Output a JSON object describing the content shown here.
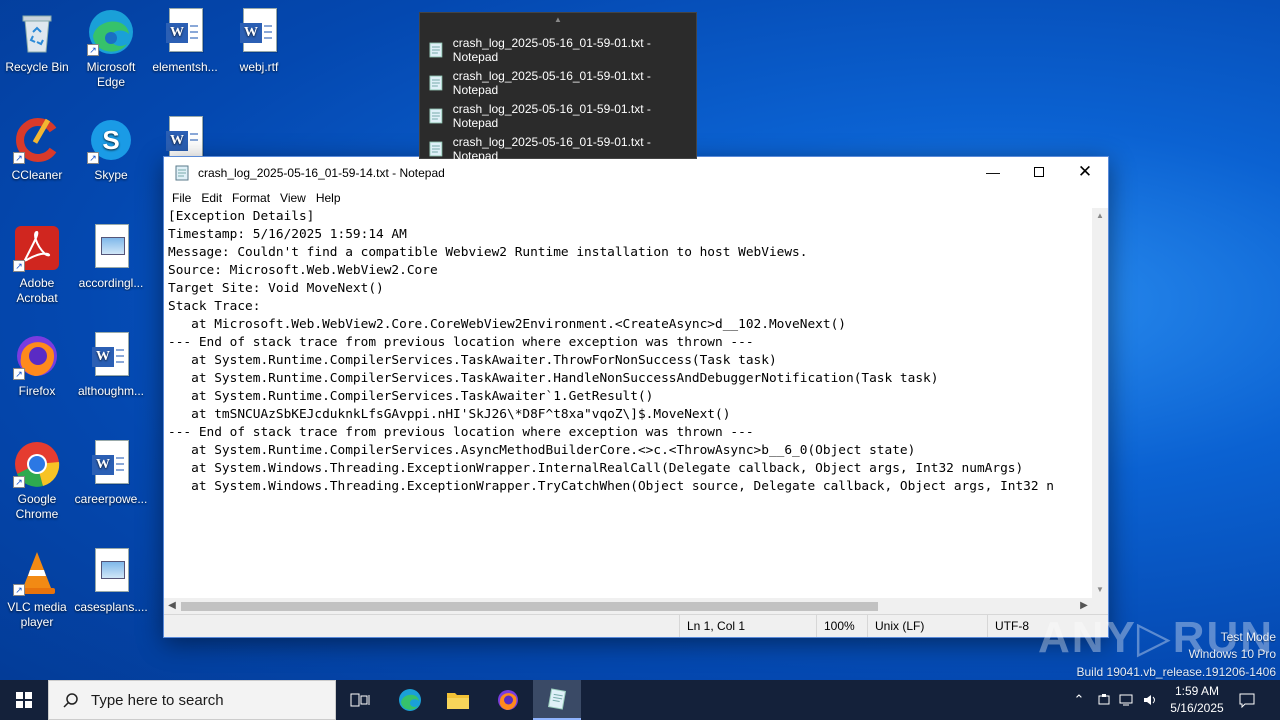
{
  "desktop": {
    "icons": [
      {
        "label": "Recycle Bin"
      },
      {
        "label": "Microsoft Edge"
      },
      {
        "label": "elementsh..."
      },
      {
        "label": "webj.rtf"
      },
      {
        "label": "CCleaner"
      },
      {
        "label": "Skype"
      },
      {
        "label": "Adobe Acrobat"
      },
      {
        "label": "accordingl..."
      },
      {
        "label": "Firefox"
      },
      {
        "label": "althoughm..."
      },
      {
        "label": "Google Chrome"
      },
      {
        "label": "careerpowe..."
      },
      {
        "label": "VLC media player"
      },
      {
        "label": "casesplans...."
      }
    ]
  },
  "jumplist": {
    "items": [
      "crash_log_2025-05-16_01-59-01.txt - Notepad",
      "crash_log_2025-05-16_01-59-01.txt - Notepad",
      "crash_log_2025-05-16_01-59-01.txt - Notepad",
      "crash_log_2025-05-16_01-59-01.txt - Notepad"
    ]
  },
  "notepad": {
    "title": "crash_log_2025-05-16_01-59-14.txt - Notepad",
    "menu": [
      "File",
      "Edit",
      "Format",
      "View",
      "Help"
    ],
    "lines": [
      "[Exception Details]",
      "Timestamp: 5/16/2025 1:59:14 AM",
      "Message: Couldn't find a compatible Webview2 Runtime installation to host WebViews.",
      "Source: Microsoft.Web.WebView2.Core",
      "Target Site: Void MoveNext()",
      "Stack Trace:",
      "   at Microsoft.Web.WebView2.Core.CoreWebView2Environment.<CreateAsync>d__102.MoveNext()",
      "--- End of stack trace from previous location where exception was thrown ---",
      "   at System.Runtime.CompilerServices.TaskAwaiter.ThrowForNonSuccess(Task task)",
      "   at System.Runtime.CompilerServices.TaskAwaiter.HandleNonSuccessAndDebuggerNotification(Task task)",
      "   at System.Runtime.CompilerServices.TaskAwaiter`1.GetResult()",
      "   at tmSNCUAzSbKEJcduknkLfsGAvppi.nHI'SkJ26\\*D8F^t8xa\"vqoZ\\]$.MoveNext()",
      "--- End of stack trace from previous location where exception was thrown ---",
      "   at System.Runtime.CompilerServices.AsyncMethodBuilderCore.<>c.<ThrowAsync>b__6_0(Object state)",
      "   at System.Windows.Threading.ExceptionWrapper.InternalRealCall(Delegate callback, Object args, Int32 numArgs)",
      "   at System.Windows.Threading.ExceptionWrapper.TryCatchWhen(Object source, Delegate callback, Object args, Int32 n"
    ],
    "status": {
      "position": "Ln 1, Col 1",
      "zoom": "100%",
      "line_ending": "Unix (LF)",
      "encoding": "UTF-8"
    },
    "hscroll_fraction": 0.78
  },
  "taskbar": {
    "search_placeholder": "Type here to search",
    "time": "1:59 AM",
    "date": "5/16/2025"
  },
  "watermark": {
    "line1": "Test Mode",
    "line2": "Windows 10 Pro",
    "line3": "Build 19041.vb_release.191206-1406",
    "brand": "ANY RUN"
  },
  "colors": {
    "desktop": "#0b62d2",
    "taskbar": "#14213a",
    "jumplist": "#2b2b2b"
  }
}
